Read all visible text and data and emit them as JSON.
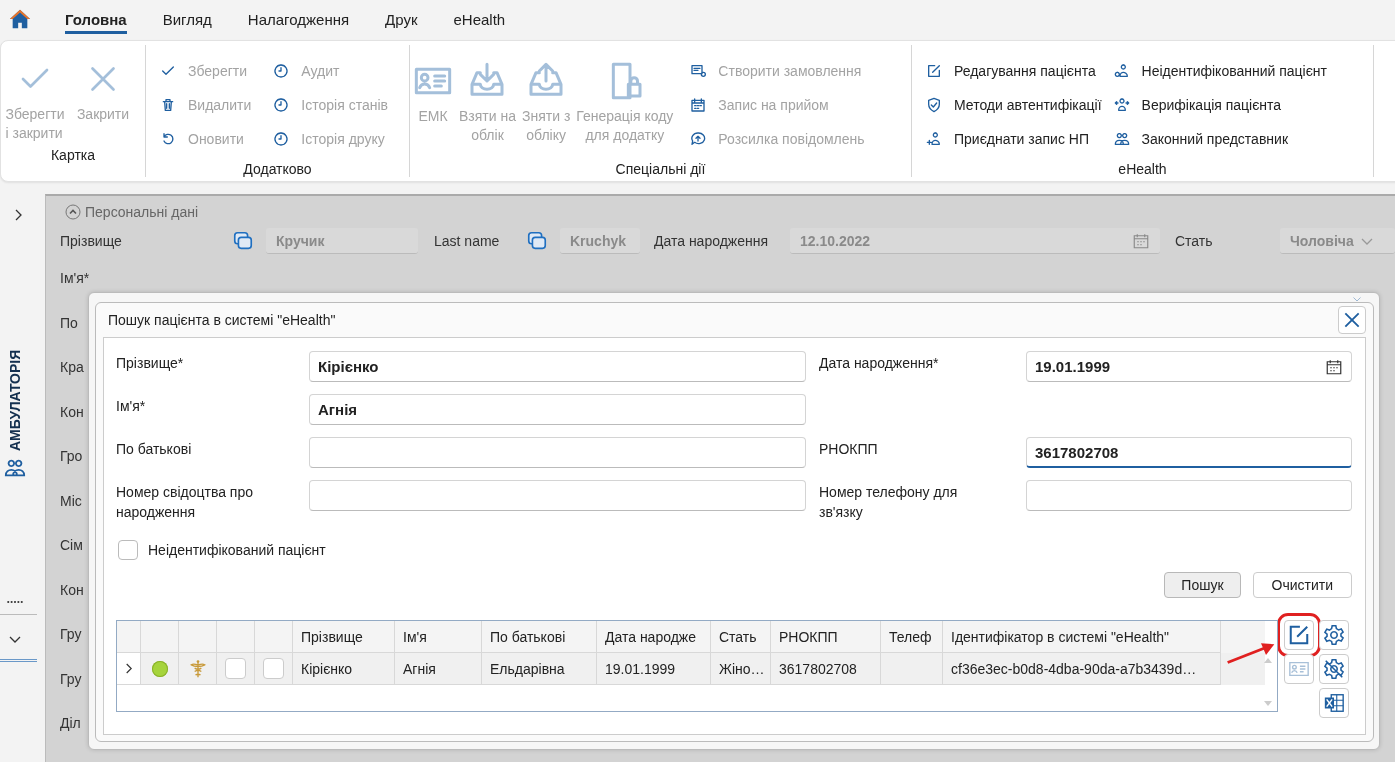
{
  "menu_tabs": [
    {
      "label": "Головна",
      "selected": true
    },
    {
      "label": "Вигляд",
      "selected": false
    },
    {
      "label": "Налагодження",
      "selected": false
    },
    {
      "label": "Друк",
      "selected": false
    },
    {
      "label": "eHealth",
      "selected": false
    }
  ],
  "ribbon": [
    {
      "title": "Картка",
      "items": [
        {
          "kind": "large",
          "label": "Зберегти\nі закрити",
          "disabled": true
        },
        {
          "kind": "large",
          "label": "Закрити",
          "disabled": true
        }
      ]
    },
    {
      "title": "Додатково",
      "items": [
        {
          "kind": "small",
          "label": "Зберегти",
          "disabled": true
        },
        {
          "kind": "small",
          "label": "Видалити",
          "disabled": true
        },
        {
          "kind": "small",
          "label": "Оновити",
          "disabled": true
        },
        {
          "kind": "small",
          "label": "Аудит",
          "disabled": true
        },
        {
          "kind": "small",
          "label": "Історія станів",
          "disabled": true
        },
        {
          "kind": "small",
          "label": "Історія друку",
          "disabled": true
        }
      ]
    },
    {
      "title": "Спеціальні дії",
      "items": [
        {
          "kind": "large",
          "label": "ЕМК",
          "disabled": true
        },
        {
          "kind": "large",
          "label": "Взяти на\nоблік",
          "disabled": true
        },
        {
          "kind": "large",
          "label": "Зняти з\nобліку",
          "disabled": true
        },
        {
          "kind": "large",
          "label": "Генерація коду\nдля додатку",
          "disabled": true
        },
        {
          "kind": "small",
          "label": "Створити замовлення",
          "disabled": true
        },
        {
          "kind": "small",
          "label": "Запис на прийом",
          "disabled": true
        },
        {
          "kind": "small",
          "label": "Розсилка повідомлень",
          "disabled": true
        }
      ]
    },
    {
      "title": "eHealth",
      "items": [
        {
          "kind": "small",
          "label": "Редагування пацієнта",
          "disabled": false
        },
        {
          "kind": "small",
          "label": "Методи автентифікації",
          "disabled": false
        },
        {
          "kind": "small",
          "label": "Приєднати запис НП",
          "disabled": false
        },
        {
          "kind": "small",
          "label": "Неідентифікованний пацієнт",
          "disabled": false
        },
        {
          "kind": "small",
          "label": "Верифікація пацієнта",
          "disabled": false
        },
        {
          "kind": "small",
          "label": "Законний представник",
          "disabled": false
        }
      ]
    }
  ],
  "sidebar": {
    "title": "АМБУЛАТОРІЯ"
  },
  "background_form": {
    "section": "Персональні дані",
    "top_row": [
      {
        "label": "Прізвище",
        "value": "Кручик",
        "disabled": true
      },
      {
        "label": "Last name",
        "value": "Kruchyk",
        "disabled": true
      },
      {
        "label": "Дата народження",
        "value": "12.10.2022",
        "disabled": true
      },
      {
        "label": "Стать",
        "value": "Чоловіча",
        "disabled": true
      }
    ],
    "left_labels": [
      "Ім'я*",
      "По",
      "Кра",
      "Кон",
      "Гро",
      "Міс",
      "Сім",
      "Кон",
      "Гру",
      "Гру",
      "Діл"
    ]
  },
  "dialog": {
    "title": "Пошук пацієнта в системі \"eHealth\"",
    "rows": [
      {
        "left": {
          "label": "Прізвище*",
          "value": "Кірієнко"
        },
        "right": {
          "label": "Дата народження*",
          "value": "19.01.1999",
          "kind": "date",
          "focused": false
        }
      },
      {
        "left": {
          "label": "Ім'я*",
          "value": "Агнія"
        }
      },
      {
        "left": {
          "label": "По батькові"
        },
        "right": {
          "label": "РНОКПП",
          "value": "3617802708",
          "kind": "text",
          "focused": true
        }
      },
      {
        "left": {
          "label": "Номер свідоцтва про\nнародження"
        },
        "right": {
          "label": "Номер телефону для\nзв'язку",
          "kind": "text",
          "focused": false
        }
      }
    ],
    "unidentified": {
      "label": "Неідентифікований пацієнт",
      "checked": false
    },
    "buttons": [
      {
        "label": "Пошук",
        "default": true
      },
      {
        "label": "Очистити",
        "default": false
      }
    ],
    "table": {
      "columns": [
        {
          "kind": "expander"
        },
        {
          "kind": "status"
        },
        {
          "kind": "icon"
        },
        {
          "kind": "check"
        },
        {
          "kind": "check"
        },
        {
          "kind": "text",
          "label": "Прізвище"
        },
        {
          "kind": "text",
          "label": "Ім'я"
        },
        {
          "kind": "text",
          "label": "По батькові"
        },
        {
          "kind": "text",
          "label": "Дата народже"
        },
        {
          "kind": "text",
          "label": "Стать"
        },
        {
          "kind": "text",
          "label": "РНОКПП"
        },
        {
          "kind": "text",
          "label": "Телеф"
        },
        {
          "kind": "text",
          "label": "Ідентифікатор в системі \"eHealth\""
        }
      ],
      "rows": [
        {
          "expanded": false,
          "checks": [
            false,
            false
          ],
          "cells": [
            "",
            "",
            "",
            "",
            "",
            "Кірієнко",
            "Агнія",
            "Ельдарівна",
            "19.01.1999",
            "Жіно…",
            "3617802708",
            "",
            "cf36e3ec-b0d8-4dba-90da-a7b3439d…"
          ]
        }
      ]
    },
    "side_tools": [
      {
        "disabled": false,
        "highlighted": true
      },
      {
        "disabled": false,
        "highlighted": false
      },
      {
        "disabled": true,
        "highlighted": false
      },
      {
        "disabled": false,
        "highlighted": false
      },
      {
        "disabled": false,
        "highlighted": false
      }
    ]
  }
}
